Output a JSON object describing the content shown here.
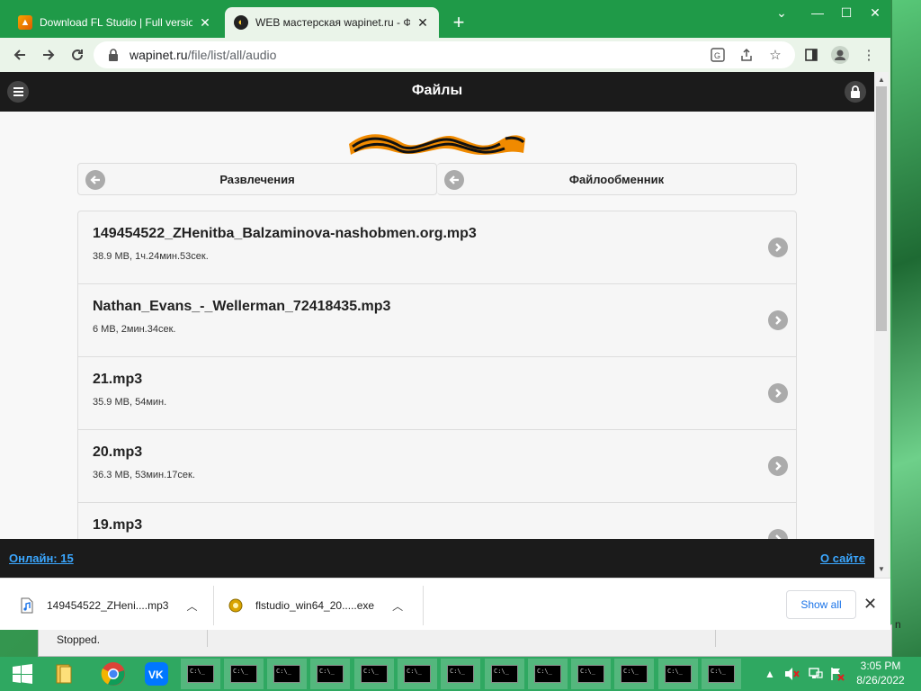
{
  "browser": {
    "tabs": [
      {
        "title": "Download FL Studio | Full version",
        "active": false
      },
      {
        "title": "WEB мастерская wapinet.ru - Фа",
        "active": true
      }
    ],
    "new_tab": "+",
    "window_controls": {
      "chevron": "⌄",
      "minimize": "—",
      "maximize": "☐",
      "close": "✕"
    },
    "address": {
      "host": "wapinet.ru",
      "path": "/file/list/all/audio"
    }
  },
  "site": {
    "header_title": "Файлы",
    "breadcrumbs": [
      {
        "label": "Развлечения"
      },
      {
        "label": "Файлообменник"
      }
    ],
    "files": [
      {
        "name": "149454522_ZHenitba_Balzaminova-nashobmen.org.mp3",
        "meta": "38.9 MB, 1ч.24мин.53сек."
      },
      {
        "name": "Nathan_Evans_-_Wellerman_72418435.mp3",
        "meta": "6 MB, 2мин.34сек."
      },
      {
        "name": "21.mp3",
        "meta": "35.9 MB, 54мин."
      },
      {
        "name": "20.mp3",
        "meta": "36.3 MB, 53мин.17сек."
      },
      {
        "name": "19.mp3",
        "meta": ""
      }
    ],
    "footer": {
      "online": "Онлайн: 15",
      "about": "О сайте"
    }
  },
  "downloads": {
    "items": [
      {
        "name": "149454522_ZHeni....mp3",
        "icon": "audio-file-icon"
      },
      {
        "name": "flstudio_win64_20.....exe",
        "icon": "installer-icon"
      }
    ],
    "show_all": "Show all"
  },
  "behind_window": {
    "status": "Stopped.",
    "edge_text": "n"
  },
  "taskbar": {
    "clock_time": "3:05 PM",
    "clock_date": "8/26/2022",
    "cmd_label": "C:\\_"
  },
  "colors": {
    "tabstrip": "#1f9a48",
    "taskbar": "#2fa861",
    "link": "#3ba7ff",
    "site_dark": "#1b1b1b"
  }
}
